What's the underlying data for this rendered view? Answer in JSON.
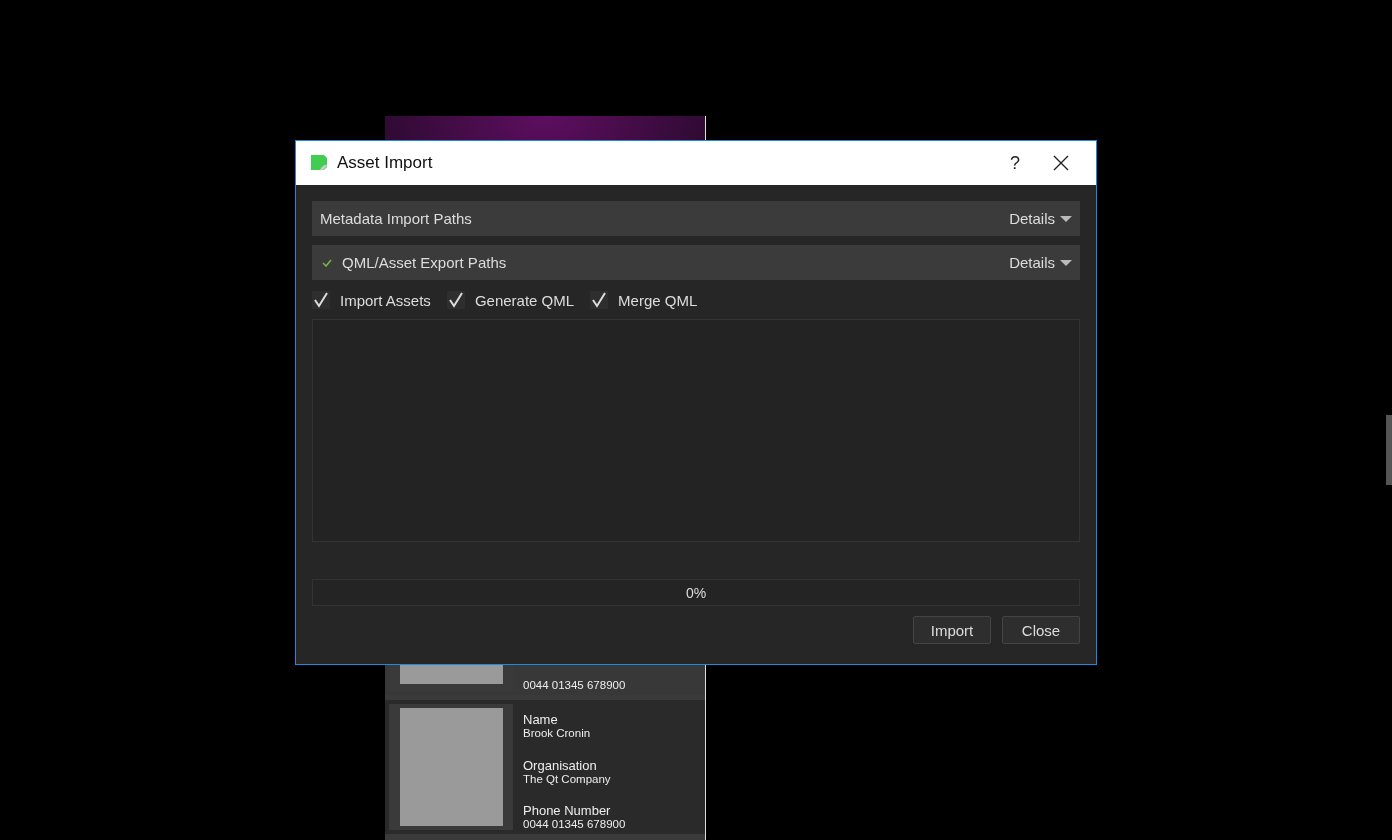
{
  "background_app": {
    "cards": [
      {
        "phone_value": "0044 01345 678900"
      },
      {
        "name_label": "Name",
        "name_value": "Brook Cronin",
        "organisation_label": "Organisation",
        "organisation_value": "The Qt Company",
        "phone_label": "Phone Number",
        "phone_value": "0044 01345 678900"
      }
    ]
  },
  "dialog": {
    "title": "Asset Import",
    "help": "?",
    "sections": [
      {
        "title": "Metadata Import Paths",
        "done": false,
        "details": "Details"
      },
      {
        "title": "QML/Asset Export Paths",
        "done": true,
        "details": "Details"
      }
    ],
    "options": [
      {
        "label": "Import Assets",
        "checked": true
      },
      {
        "label": "Generate QML",
        "checked": true
      },
      {
        "label": "Merge QML",
        "checked": true
      }
    ],
    "progress": {
      "level": 0,
      "reading": "0%"
    },
    "buttons": [
      "Import",
      "Close"
    ]
  }
}
